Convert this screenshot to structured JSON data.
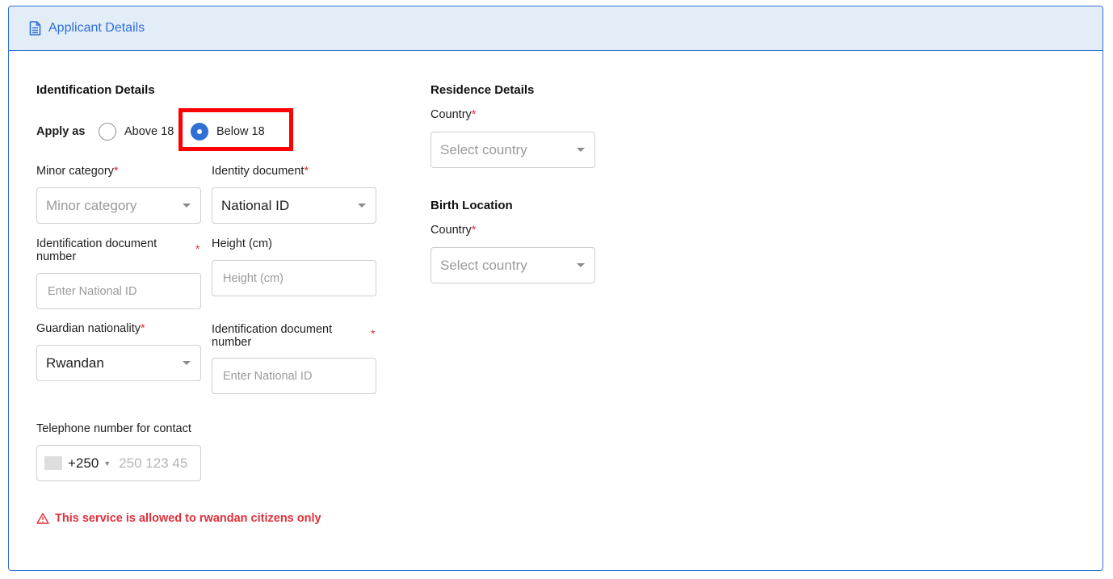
{
  "panel": {
    "title": "Applicant Details"
  },
  "identification": {
    "title": "Identification Details",
    "apply_as_label": "Apply as",
    "options": [
      "Above 18",
      "Below 18"
    ],
    "selected": "Below 18",
    "minor_category": {
      "label": "Minor category",
      "required": "*",
      "placeholder": "Minor category"
    },
    "identity_document": {
      "label": "Identity document",
      "required": "*",
      "value": "National ID"
    },
    "id_doc_number": {
      "label": "Identification document number",
      "required": "*",
      "placeholder": "Enter National ID"
    },
    "height": {
      "label": "Height (cm)",
      "placeholder": "Height (cm)"
    },
    "guardian_nationality": {
      "label": "Guardian nationality",
      "required": "*",
      "value": "Rwandan"
    },
    "guardian_id_doc_number": {
      "label": "Identification document number",
      "required": "*",
      "placeholder": "Enter National ID"
    },
    "telephone": {
      "label": "Telephone number for contact",
      "code": "+250",
      "placeholder": "250 123 45"
    },
    "warning": "This service is allowed to rwandan citizens only"
  },
  "residence": {
    "title": "Residence Details",
    "country_label": "Country",
    "required": "*",
    "country_placeholder": "Select country"
  },
  "birth": {
    "title": "Birth Location",
    "country_label": "Country",
    "required": "*",
    "country_placeholder": "Select country"
  },
  "colors": {
    "accent": "#2f6fd6",
    "header_bg": "#e3edf8",
    "error": "#e0303a",
    "highlight": "#ff0000"
  }
}
